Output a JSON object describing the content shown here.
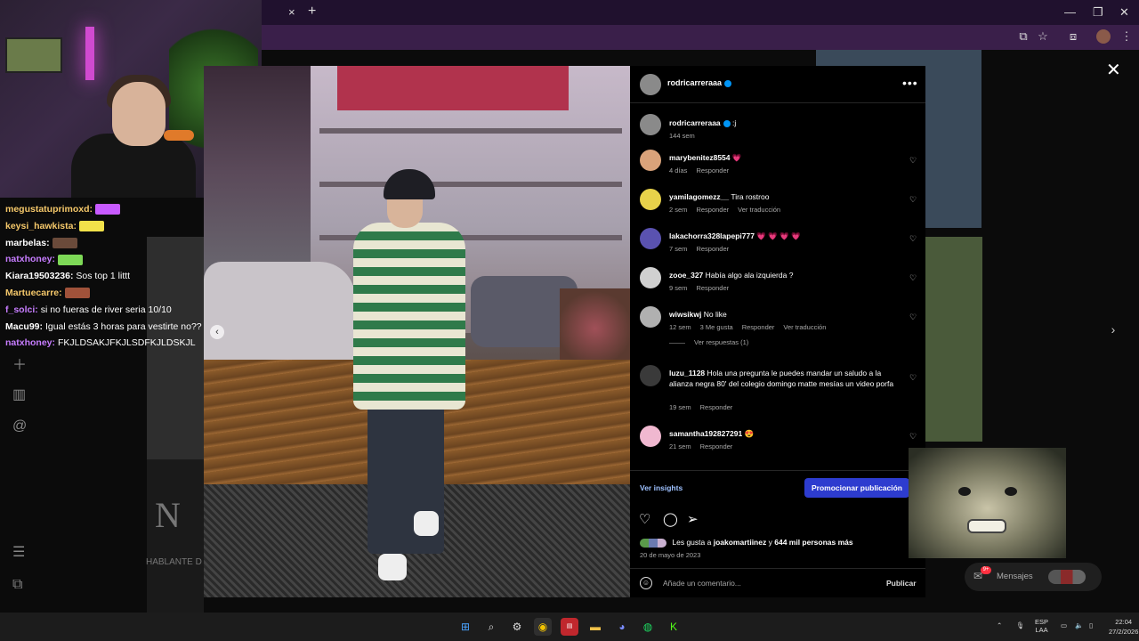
{
  "browser": {
    "tab_close": "×",
    "tab_new": "+",
    "window_controls": [
      "—",
      "❐",
      "✕"
    ]
  },
  "overlay": {
    "close": "✕",
    "next": "›",
    "prev": "‹"
  },
  "background": {
    "letter": "N",
    "caption": "HABLANTE D"
  },
  "chat": [
    {
      "user": "megustatuprimoxd:",
      "color": "#f5c86a",
      "message": "",
      "emote_color": "#c85aff"
    },
    {
      "user": "keysi_hawkista:",
      "color": "#f5c86a",
      "message": "",
      "emote_color": "#f2e24a"
    },
    {
      "user": "marbelas:",
      "color": "#ffffff",
      "message": "",
      "emote_color": "#6a4a3a"
    },
    {
      "user": "natxhoney:",
      "color": "#c77dff",
      "message": "",
      "emote_color": "#7ed957"
    },
    {
      "user": "Kiara19503236:",
      "color": "#ffffff",
      "message": "Sos top 1 littt",
      "emote_color": ""
    },
    {
      "user": "Martuecarre:",
      "color": "#f5c86a",
      "message": "",
      "emote_color": "#a0523a"
    },
    {
      "user": "f_solci:",
      "color": "#c77dff",
      "message": "si no fueras de river seria 10/10",
      "emote_color": ""
    },
    {
      "user": "Macu99:",
      "color": "#ffffff",
      "message": "Igual estás 3 horas para vestirte no?? 🤣🤣",
      "emote_color": ""
    },
    {
      "user": "natxhoney:",
      "color": "#c77dff",
      "message": "FKJLDSAKJFKJLSDFKJLDSKJL",
      "emote_color": ""
    }
  ],
  "post": {
    "author": "rodricarreraaa",
    "caption_user": "rodricarreraaa",
    "caption_text": ":j",
    "caption_time": "144 sem",
    "comments": [
      {
        "user": "marybenitez8554",
        "text": "💗",
        "time": "4 días",
        "actions": [
          "Responder"
        ],
        "avatar_color": "#d9a27a"
      },
      {
        "user": "yamilagomezz__",
        "text": "Tira rostroo",
        "time": "2 sem",
        "actions": [
          "Responder",
          "Ver traducción"
        ],
        "avatar_color": "#e8d24a"
      },
      {
        "user": "lakachorra328lapepi777",
        "text": "💗 💗 💗 💗",
        "time": "7 sem",
        "actions": [
          "Responder"
        ],
        "avatar_color": "#5a52b0"
      },
      {
        "user": "zooe_327",
        "text": "Había algo ala izquierda ?",
        "time": "9 sem",
        "actions": [
          "Responder"
        ],
        "avatar_color": "#d0d0d0"
      },
      {
        "user": "wiwsikwj",
        "text": "No like",
        "time": "12 sem",
        "actions": [
          "3 Me gusta",
          "Responder",
          "Ver traducción"
        ],
        "avatar_color": "#b0b0b0"
      },
      {
        "user": "luzu_1128",
        "text": "Hola una pregunta le puedes mandar un saludo a la alianza negra 80' del colegio domingo matte mesías un video porfa",
        "time": "19 sem",
        "actions": [
          "Responder"
        ],
        "avatar_color": "#3a3a3a"
      },
      {
        "user": "samantha192827291",
        "text": "😍",
        "time": "21 sem",
        "actions": [
          "Responder"
        ],
        "avatar_color": "#f0b8d0"
      }
    ],
    "view_replies": "Ver respuestas (1)",
    "insights": "Ver insights",
    "promote": "Promocionar publicación",
    "likes_prefix": "Les gusta a",
    "likes_user": "joakomartiinez",
    "likes_mid": "y",
    "likes_count": "644 mil personas más",
    "date": "20 de mayo de 2023",
    "comment_placeholder": "Añade un comentario...",
    "publish": "Publicar"
  },
  "messages": {
    "label": "Mensajes",
    "badge": "9+"
  },
  "taskbar": {
    "lang": "ESP",
    "lang2": "LAA",
    "time": "22:04",
    "date": "27/2/2026"
  }
}
